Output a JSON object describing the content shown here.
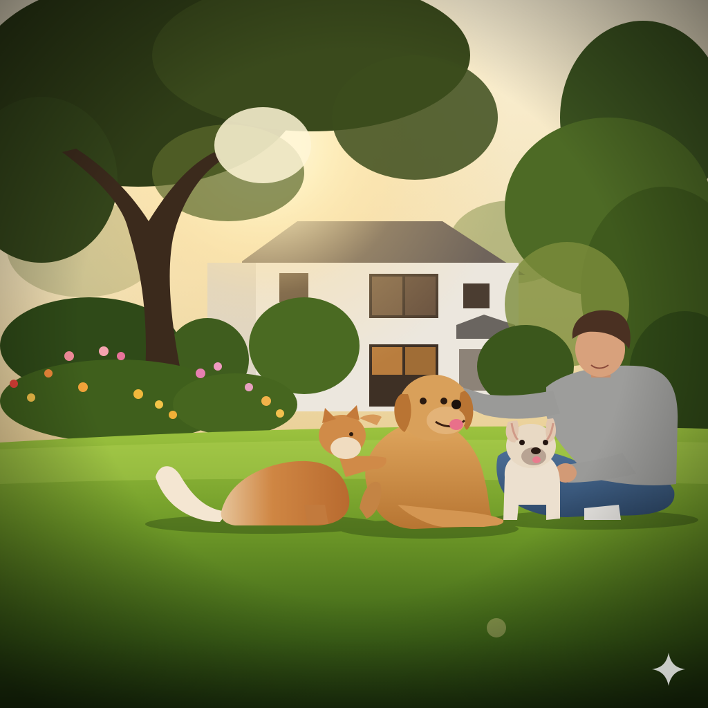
{
  "scene": {
    "subjects": [
      "man",
      "golden-retriever",
      "orange-cat",
      "french-bulldog"
    ],
    "colors": {
      "sky": "#f3e7c9",
      "sun": "#fff3c4",
      "grass_light": "#8fb838",
      "grass_dark": "#1f3a10",
      "house": "#e9e4da",
      "roof": "#6e6258",
      "foliage": "#3c5a1c",
      "shirt": "#9a9a98",
      "jeans": "#3f5f86",
      "dog": "#c98b45",
      "cat": "#c4773b",
      "bulldog": "#e6d8c6"
    }
  },
  "watermark": {
    "icon": "sparkle-icon"
  }
}
